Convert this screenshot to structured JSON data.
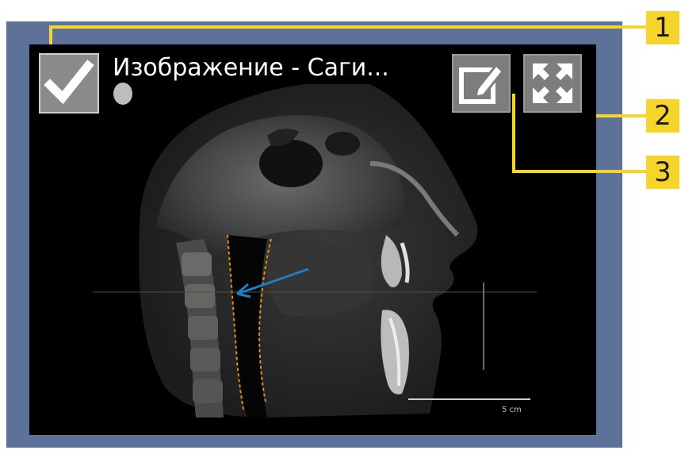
{
  "viewer": {
    "title": "Изображение - Саги...",
    "visibility_checked": true,
    "check_icon": "checkmark-icon",
    "edit_icon": "edit-pencil-icon",
    "maximize_icon": "maximize-arrows-icon",
    "scale_label": "5 cm"
  },
  "callouts": {
    "c1": "1",
    "c2": "2",
    "c3": "3"
  },
  "colors": {
    "frame": "#5e7198",
    "callout": "#f6d52a",
    "airway_outline": "#e08a1e",
    "arrow": "#1e7fc8"
  }
}
